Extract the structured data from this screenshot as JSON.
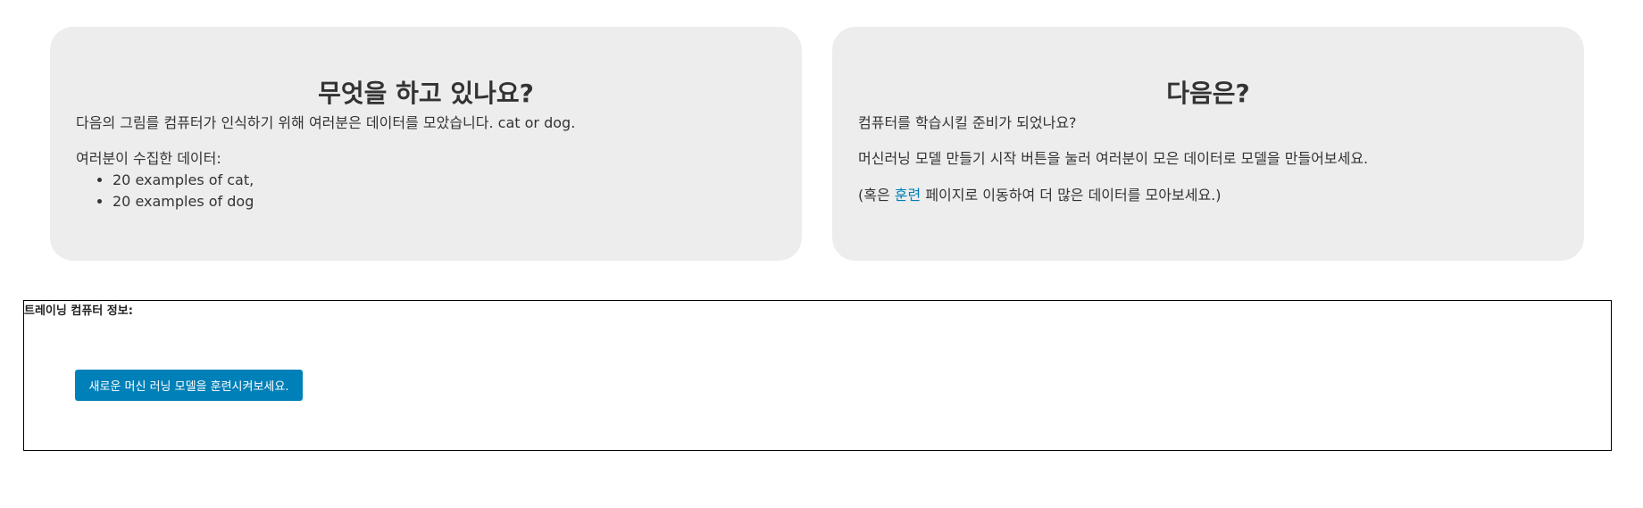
{
  "left_card": {
    "title": "무엇을 하고 있나요?",
    "intro_prefix": "다음의 그림를 컴퓨터가 인식하기 위해 여러분은 데이터를 모았습니다.",
    "intro_labels": "cat or dog.",
    "collected_label": "여러분이 수집한 데이터:",
    "examples": [
      "20 examples of cat,",
      "20 examples of dog"
    ]
  },
  "right_card": {
    "title": "다음은?",
    "ready_text": "컴퓨터를 학습시킬 준비가 되었나요?",
    "instruction_text": "머신러닝 모델 만들기 시작 버튼을 눌러 여러분이 모은 데이터로 모델을 만들어보세요.",
    "alt_prefix": "(혹은",
    "alt_link": "훈련",
    "alt_suffix": "페이지로 이동하여 더 많은 데이터를 모아보세요.)"
  },
  "training_section": {
    "title": "트레이닝 컴퓨터 정보:",
    "button_label": "새로운 머신 러닝 모델을 훈련시켜보세요."
  },
  "colors": {
    "card_background": "#ededed",
    "accent": "#0080b8"
  }
}
